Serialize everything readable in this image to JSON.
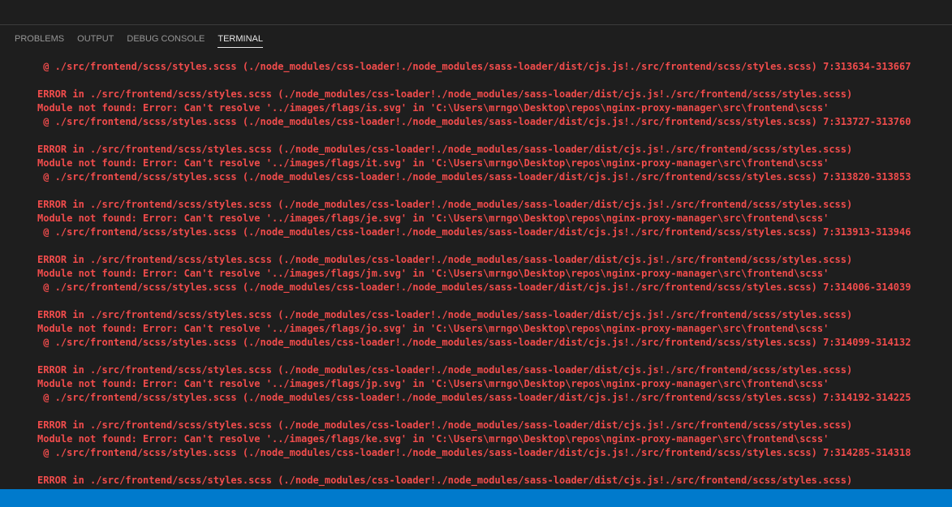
{
  "panel": {
    "tabs": [
      {
        "label": "PROBLEMS",
        "active": false
      },
      {
        "label": "OUTPUT",
        "active": false
      },
      {
        "label": "DEBUG CONSOLE",
        "active": false
      },
      {
        "label": "TERMINAL",
        "active": true
      }
    ]
  },
  "terminal": {
    "text_color": "#f14c4c",
    "lines": [
      " @ ./src/frontend/scss/styles.scss (./node_modules/css-loader!./node_modules/sass-loader/dist/cjs.js!./src/frontend/scss/styles.scss) 7:313634-313667",
      "",
      "ERROR in ./src/frontend/scss/styles.scss (./node_modules/css-loader!./node_modules/sass-loader/dist/cjs.js!./src/frontend/scss/styles.scss)",
      "Module not found: Error: Can't resolve '../images/flags/is.svg' in 'C:\\Users\\mrngo\\Desktop\\repos\\nginx-proxy-manager\\src\\frontend\\scss'",
      " @ ./src/frontend/scss/styles.scss (./node_modules/css-loader!./node_modules/sass-loader/dist/cjs.js!./src/frontend/scss/styles.scss) 7:313727-313760",
      "",
      "ERROR in ./src/frontend/scss/styles.scss (./node_modules/css-loader!./node_modules/sass-loader/dist/cjs.js!./src/frontend/scss/styles.scss)",
      "Module not found: Error: Can't resolve '../images/flags/it.svg' in 'C:\\Users\\mrngo\\Desktop\\repos\\nginx-proxy-manager\\src\\frontend\\scss'",
      " @ ./src/frontend/scss/styles.scss (./node_modules/css-loader!./node_modules/sass-loader/dist/cjs.js!./src/frontend/scss/styles.scss) 7:313820-313853",
      "",
      "ERROR in ./src/frontend/scss/styles.scss (./node_modules/css-loader!./node_modules/sass-loader/dist/cjs.js!./src/frontend/scss/styles.scss)",
      "Module not found: Error: Can't resolve '../images/flags/je.svg' in 'C:\\Users\\mrngo\\Desktop\\repos\\nginx-proxy-manager\\src\\frontend\\scss'",
      " @ ./src/frontend/scss/styles.scss (./node_modules/css-loader!./node_modules/sass-loader/dist/cjs.js!./src/frontend/scss/styles.scss) 7:313913-313946",
      "",
      "ERROR in ./src/frontend/scss/styles.scss (./node_modules/css-loader!./node_modules/sass-loader/dist/cjs.js!./src/frontend/scss/styles.scss)",
      "Module not found: Error: Can't resolve '../images/flags/jm.svg' in 'C:\\Users\\mrngo\\Desktop\\repos\\nginx-proxy-manager\\src\\frontend\\scss'",
      " @ ./src/frontend/scss/styles.scss (./node_modules/css-loader!./node_modules/sass-loader/dist/cjs.js!./src/frontend/scss/styles.scss) 7:314006-314039",
      "",
      "ERROR in ./src/frontend/scss/styles.scss (./node_modules/css-loader!./node_modules/sass-loader/dist/cjs.js!./src/frontend/scss/styles.scss)",
      "Module not found: Error: Can't resolve '../images/flags/jo.svg' in 'C:\\Users\\mrngo\\Desktop\\repos\\nginx-proxy-manager\\src\\frontend\\scss'",
      " @ ./src/frontend/scss/styles.scss (./node_modules/css-loader!./node_modules/sass-loader/dist/cjs.js!./src/frontend/scss/styles.scss) 7:314099-314132",
      "",
      "ERROR in ./src/frontend/scss/styles.scss (./node_modules/css-loader!./node_modules/sass-loader/dist/cjs.js!./src/frontend/scss/styles.scss)",
      "Module not found: Error: Can't resolve '../images/flags/jp.svg' in 'C:\\Users\\mrngo\\Desktop\\repos\\nginx-proxy-manager\\src\\frontend\\scss'",
      " @ ./src/frontend/scss/styles.scss (./node_modules/css-loader!./node_modules/sass-loader/dist/cjs.js!./src/frontend/scss/styles.scss) 7:314192-314225",
      "",
      "ERROR in ./src/frontend/scss/styles.scss (./node_modules/css-loader!./node_modules/sass-loader/dist/cjs.js!./src/frontend/scss/styles.scss)",
      "Module not found: Error: Can't resolve '../images/flags/ke.svg' in 'C:\\Users\\mrngo\\Desktop\\repos\\nginx-proxy-manager\\src\\frontend\\scss'",
      " @ ./src/frontend/scss/styles.scss (./node_modules/css-loader!./node_modules/sass-loader/dist/cjs.js!./src/frontend/scss/styles.scss) 7:314285-314318",
      "",
      "ERROR in ./src/frontend/scss/styles.scss (./node_modules/css-loader!./node_modules/sass-loader/dist/cjs.js!./src/frontend/scss/styles.scss)"
    ]
  },
  "statusbar": {
    "color": "#007acc"
  }
}
